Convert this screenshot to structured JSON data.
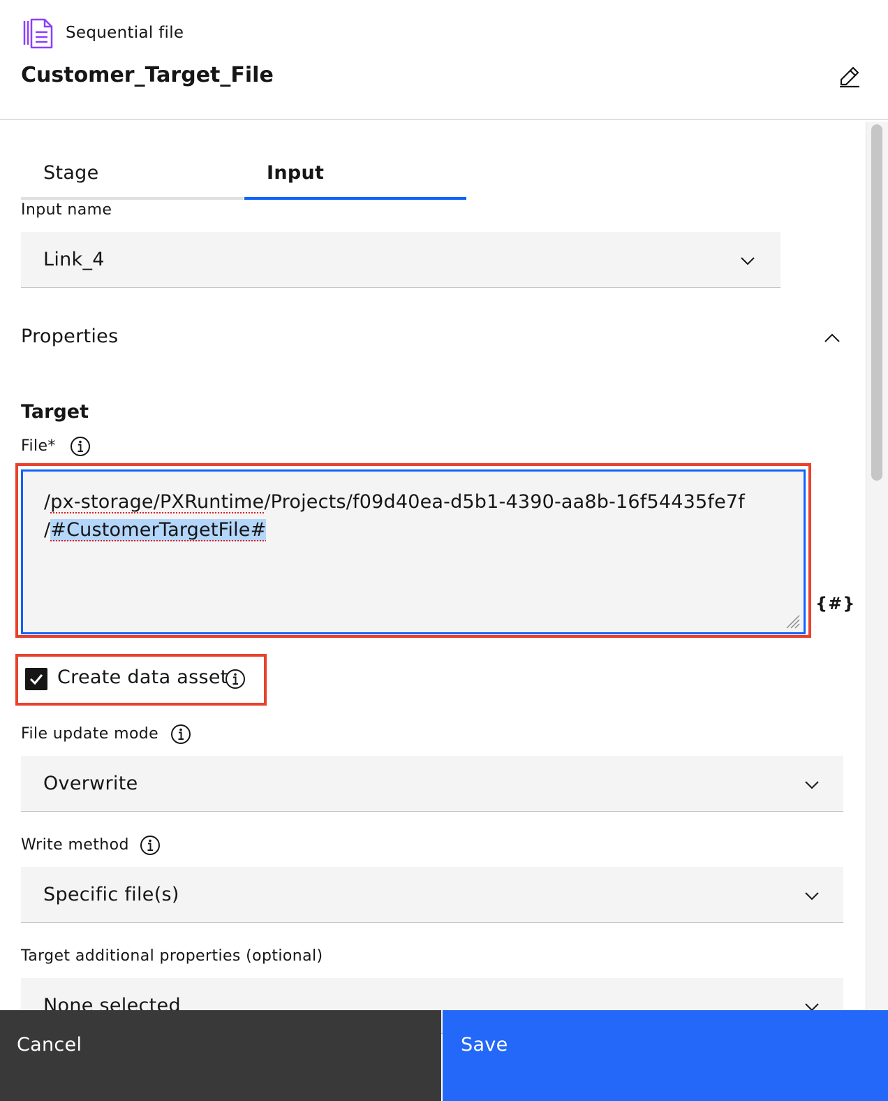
{
  "header": {
    "stage_type": "Sequential file",
    "stage_name": "Customer_Target_File",
    "stage_icon": "sequential-file-icon",
    "edit_icon": "edit-icon"
  },
  "tabs": [
    {
      "label": "Stage",
      "selected": false
    },
    {
      "label": "Input",
      "selected": true
    }
  ],
  "input_name": {
    "label": "Input name",
    "value": "Link_4"
  },
  "properties": {
    "title": "Properties",
    "expanded": true
  },
  "target": {
    "heading": "Target",
    "file": {
      "label": "File*",
      "line1_prefix": "/",
      "line1_squiggle": "px-storage/PXRuntime",
      "line1_rest": "/Projects/f09d40ea-d5b1-4390-aa8b-16f54435fe7f",
      "line2_prefix": "/",
      "line2_highlight": "#CustomerTargetFile#",
      "param_button": "{#}"
    },
    "create_data_asset": {
      "label": "Create data asset",
      "checked": true
    },
    "file_update_mode": {
      "label": "File update mode",
      "value": "Overwrite"
    },
    "write_method": {
      "label": "Write method",
      "value": "Specific file(s)"
    },
    "additional_properties": {
      "label": "Target additional properties (optional)",
      "value": "None selected"
    }
  },
  "footer": {
    "cancel_label": "Cancel",
    "save_label": "Save"
  },
  "colors": {
    "accent": "#0f62fe",
    "save_button": "#2368f8",
    "cancel_button": "#393939",
    "annotation": "#e8412c",
    "icon_purple": "#8a3ffc"
  }
}
